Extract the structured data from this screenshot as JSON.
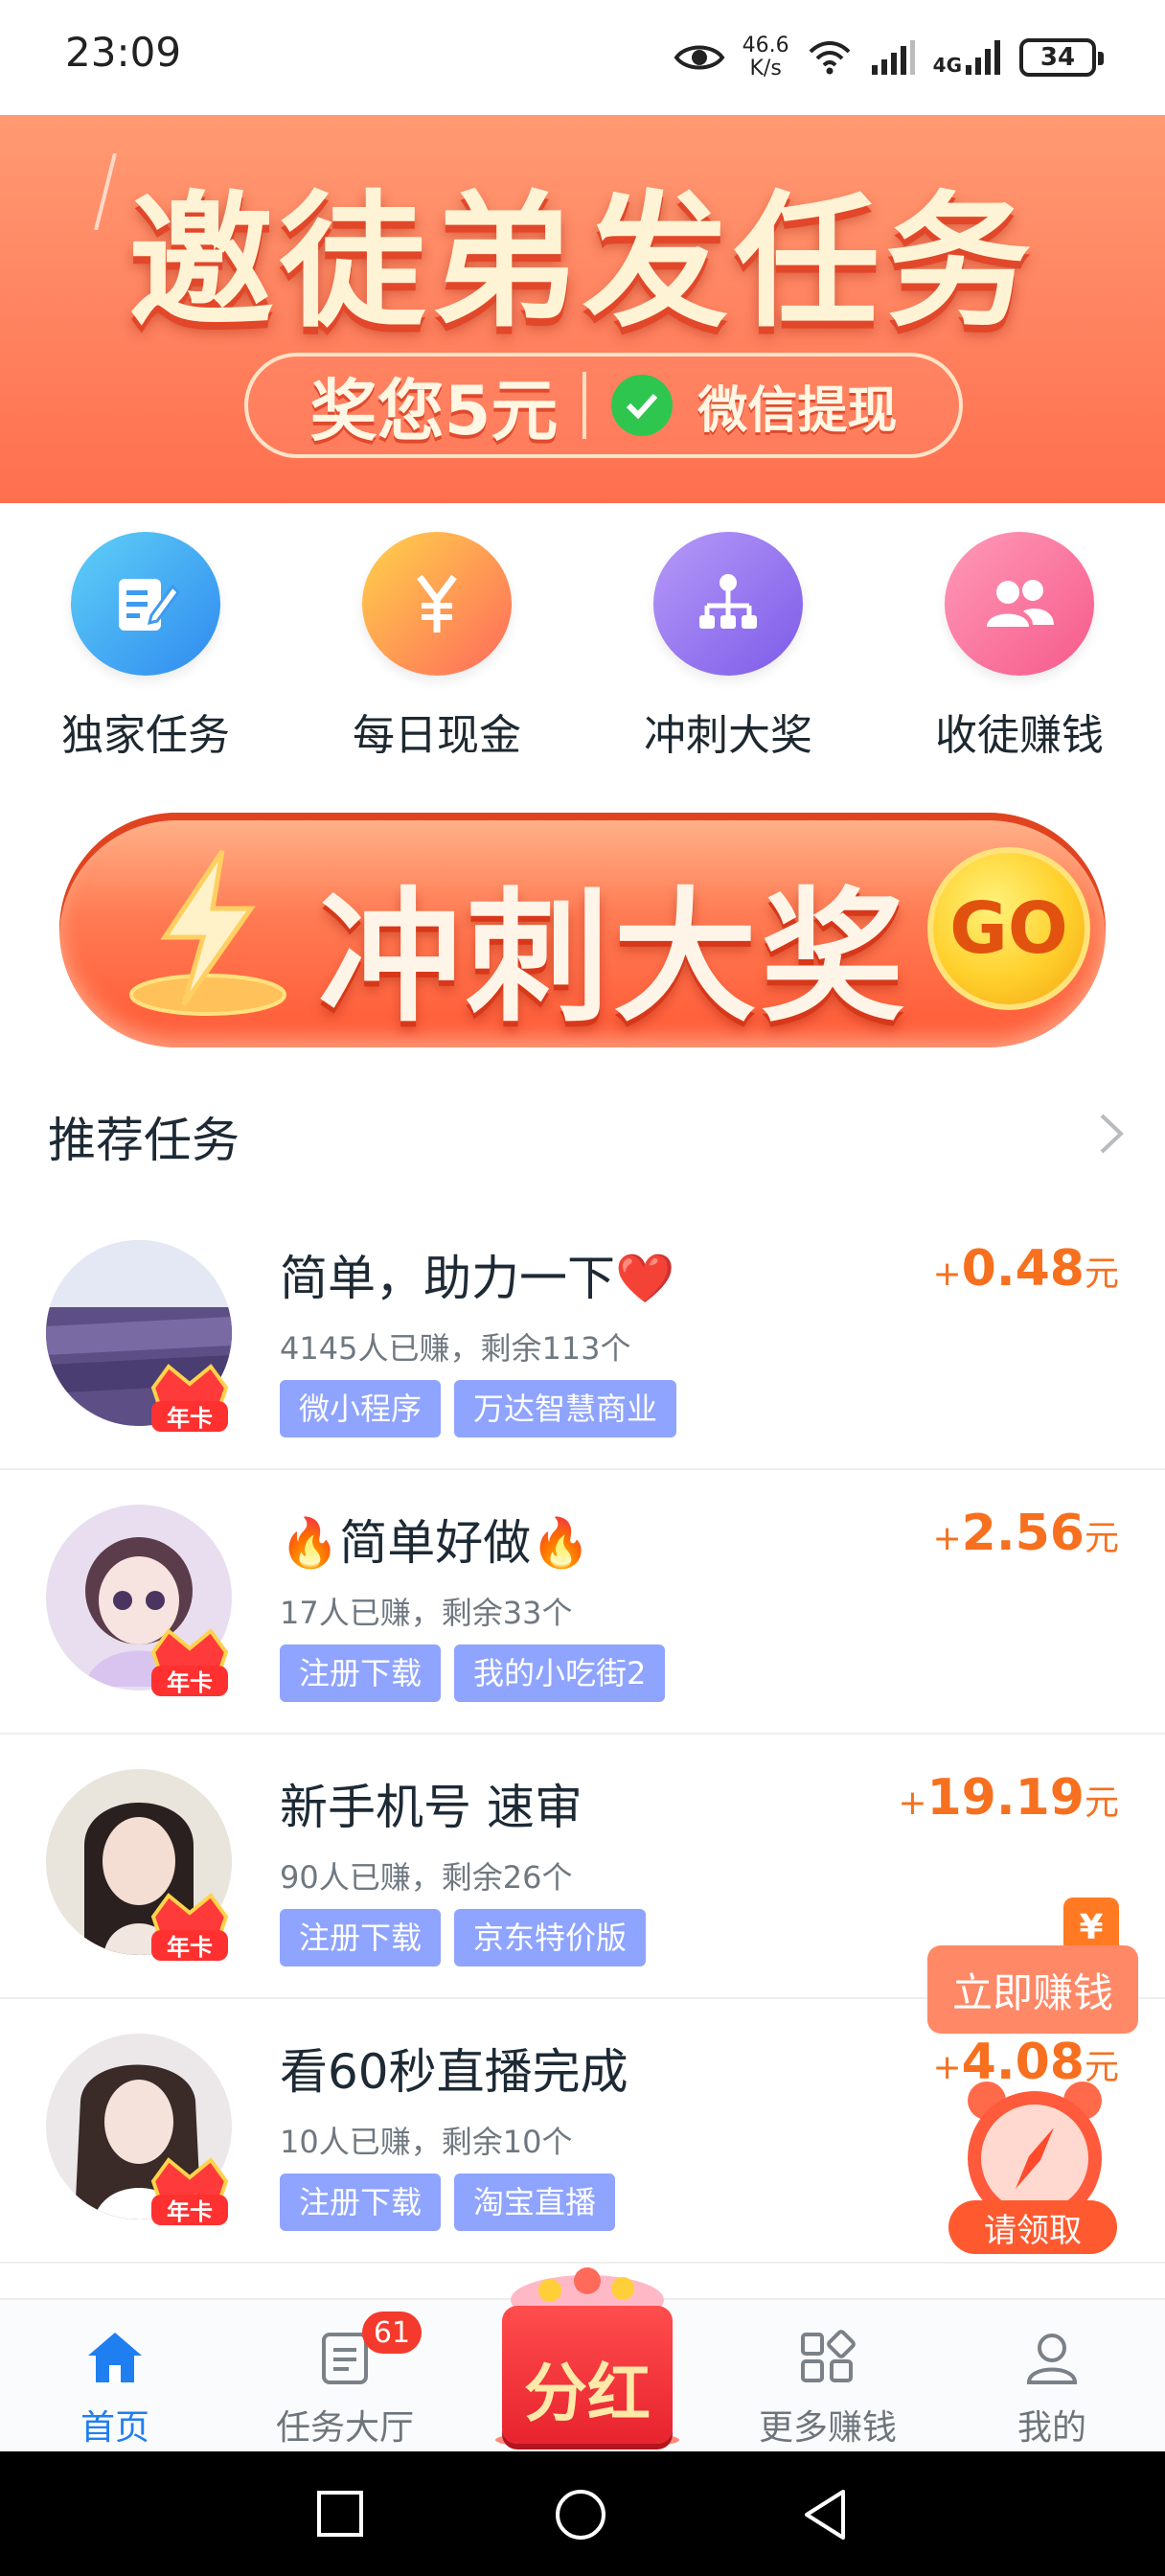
{
  "status_bar": {
    "time": "23:09",
    "net_speed_value": "46.6",
    "net_speed_unit": "K/s",
    "network_type": "4G",
    "battery": "34"
  },
  "banner": {
    "title": "邀徒弟发任务",
    "reward": "奖您5元",
    "withdraw": "微信提现",
    "slides": 3,
    "active_slide": 1
  },
  "quick_menu": [
    {
      "label": "独家任务",
      "icon": "edit-icon",
      "color_from": "#5fd0f6",
      "color_to": "#2f8af0"
    },
    {
      "label": "每日现金",
      "icon": "yuan-icon",
      "color_from": "#ffd24a",
      "color_to": "#ff6a5c"
    },
    {
      "label": "冲刺大奖",
      "icon": "network-icon",
      "color_from": "#b69af8",
      "color_to": "#7d5be8"
    },
    {
      "label": "收徒赚钱",
      "icon": "users-icon",
      "color_from": "#ff9ab8",
      "color_to": "#f65a8b"
    }
  ],
  "sprint": {
    "title": "冲刺大奖",
    "go": "GO"
  },
  "recommend": {
    "title": "推荐任务"
  },
  "tasks": [
    {
      "title": "简单，助力一下❤️",
      "stats": "4145人已赚，剩余113个",
      "tags": [
        "微小程序",
        "万达智慧商业"
      ],
      "plus": "+",
      "amount": "0.48",
      "unit": "元",
      "badge": "年卡"
    },
    {
      "title": "🔥简单好做🔥",
      "stats": "17人已赚，剩余33个",
      "tags": [
        "注册下载",
        "我的小吃街2"
      ],
      "plus": "+",
      "amount": "2.56",
      "unit": "元",
      "badge": "年卡"
    },
    {
      "title": "新手机号 速审",
      "stats": "90人已赚，剩余26个",
      "tags": [
        "注册下载",
        "京东特价版"
      ],
      "plus": "+",
      "amount": "19.19",
      "unit": "元",
      "badge": "年卡"
    },
    {
      "title": "看60秒直播完成",
      "stats": "10人已赚，剩余10个",
      "tags": [
        "注册下载",
        "淘宝直播"
      ],
      "plus": "+",
      "amount": "4.08",
      "unit": "元",
      "badge": "年卡"
    }
  ],
  "floating": {
    "wallet": "¥",
    "earn_now": "立即赚钱",
    "claim": "请领取"
  },
  "bottom_nav": {
    "home": "首页",
    "tasks": "任务大厅",
    "tasks_badge": "61",
    "dividend": "分红",
    "more": "更多赚钱",
    "mine": "我的"
  },
  "colors": {
    "accent_blue": "#1f7ff0",
    "reward_orange": "#f6701f",
    "tag_blue": "#8fa4ff"
  }
}
